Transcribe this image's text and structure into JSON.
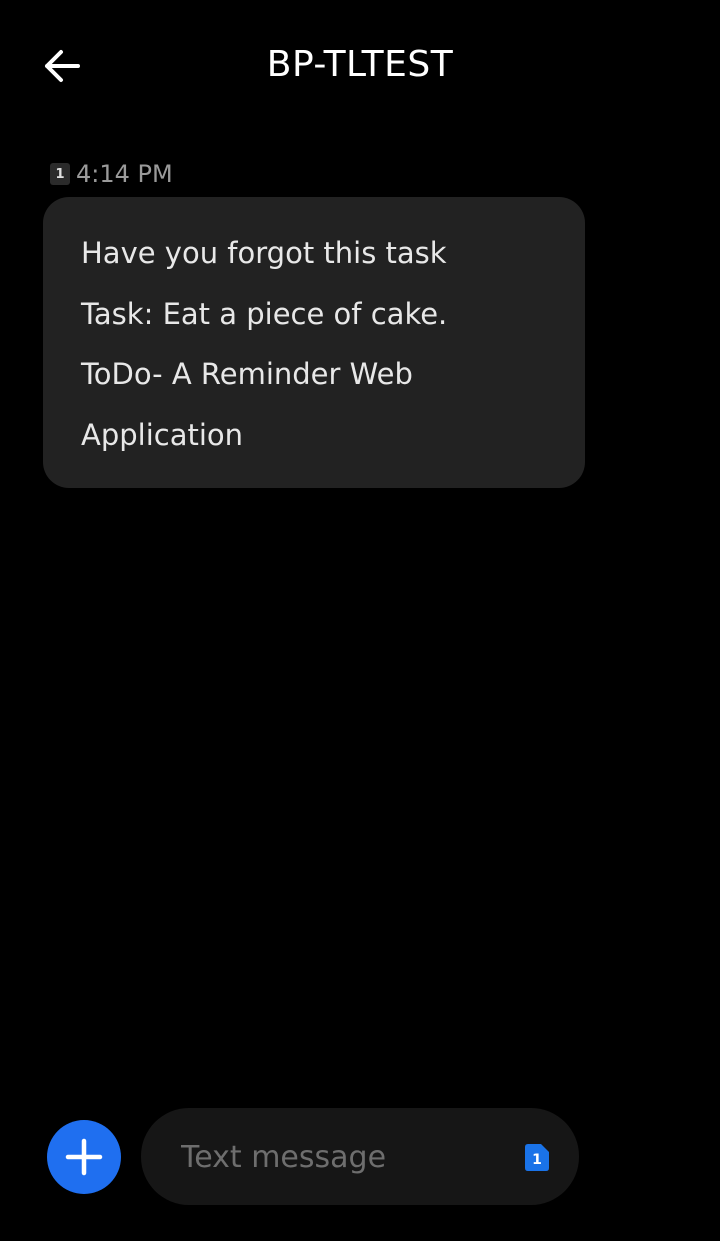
{
  "header": {
    "title": "BP-TLTEST",
    "back_icon": "arrow-left-icon"
  },
  "message": {
    "sim_label": "1",
    "time": "4:14 PM",
    "lines": [
      "Have you forgot this task",
      "Task: Eat a piece of cake.",
      "ToDo- A Reminder Web",
      "Application"
    ]
  },
  "composer": {
    "add_icon": "plus-icon",
    "placeholder": "Text message",
    "value": "",
    "sim_label": "1",
    "sim_color": "#1a73e8"
  },
  "colors": {
    "background": "#000000",
    "bubble": "#222222",
    "accent": "#1f6ff0"
  }
}
